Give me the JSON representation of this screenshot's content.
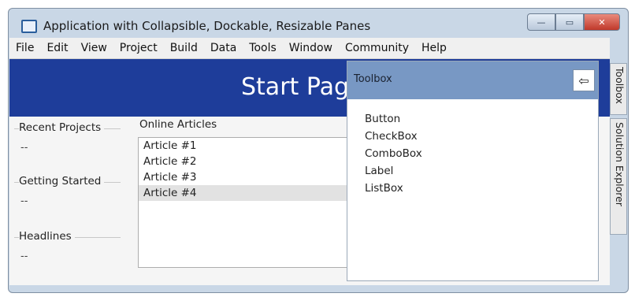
{
  "window": {
    "title": "Application with Collapsible, Dockable, Resizable Panes",
    "buttons": {
      "minimize": "—",
      "maximize": "▭",
      "close": "✕"
    }
  },
  "menu": [
    "File",
    "Edit",
    "View",
    "Project",
    "Build",
    "Data",
    "Tools",
    "Window",
    "Community",
    "Help"
  ],
  "banner": {
    "title": "Start Page"
  },
  "left_sections": [
    {
      "title": "Recent Projects",
      "value": "--"
    },
    {
      "title": "Getting Started",
      "value": "--"
    },
    {
      "title": "Headlines",
      "value": "--"
    }
  ],
  "articles": {
    "title": "Online Articles",
    "items": [
      "Article #1",
      "Article #2",
      "Article #3",
      "Article #4"
    ],
    "selected_index": 3
  },
  "toolbox": {
    "title": "Toolbox",
    "pin_icon": "⇦",
    "items": [
      "Button",
      "CheckBox",
      "ComboBox",
      "Label",
      "ListBox"
    ]
  },
  "side_tabs": [
    "Toolbox",
    "Solution Explorer"
  ],
  "colors": {
    "banner": "#1e3d9a",
    "toolbox_header": "#7898c4",
    "frame": "#c9d7e6"
  }
}
